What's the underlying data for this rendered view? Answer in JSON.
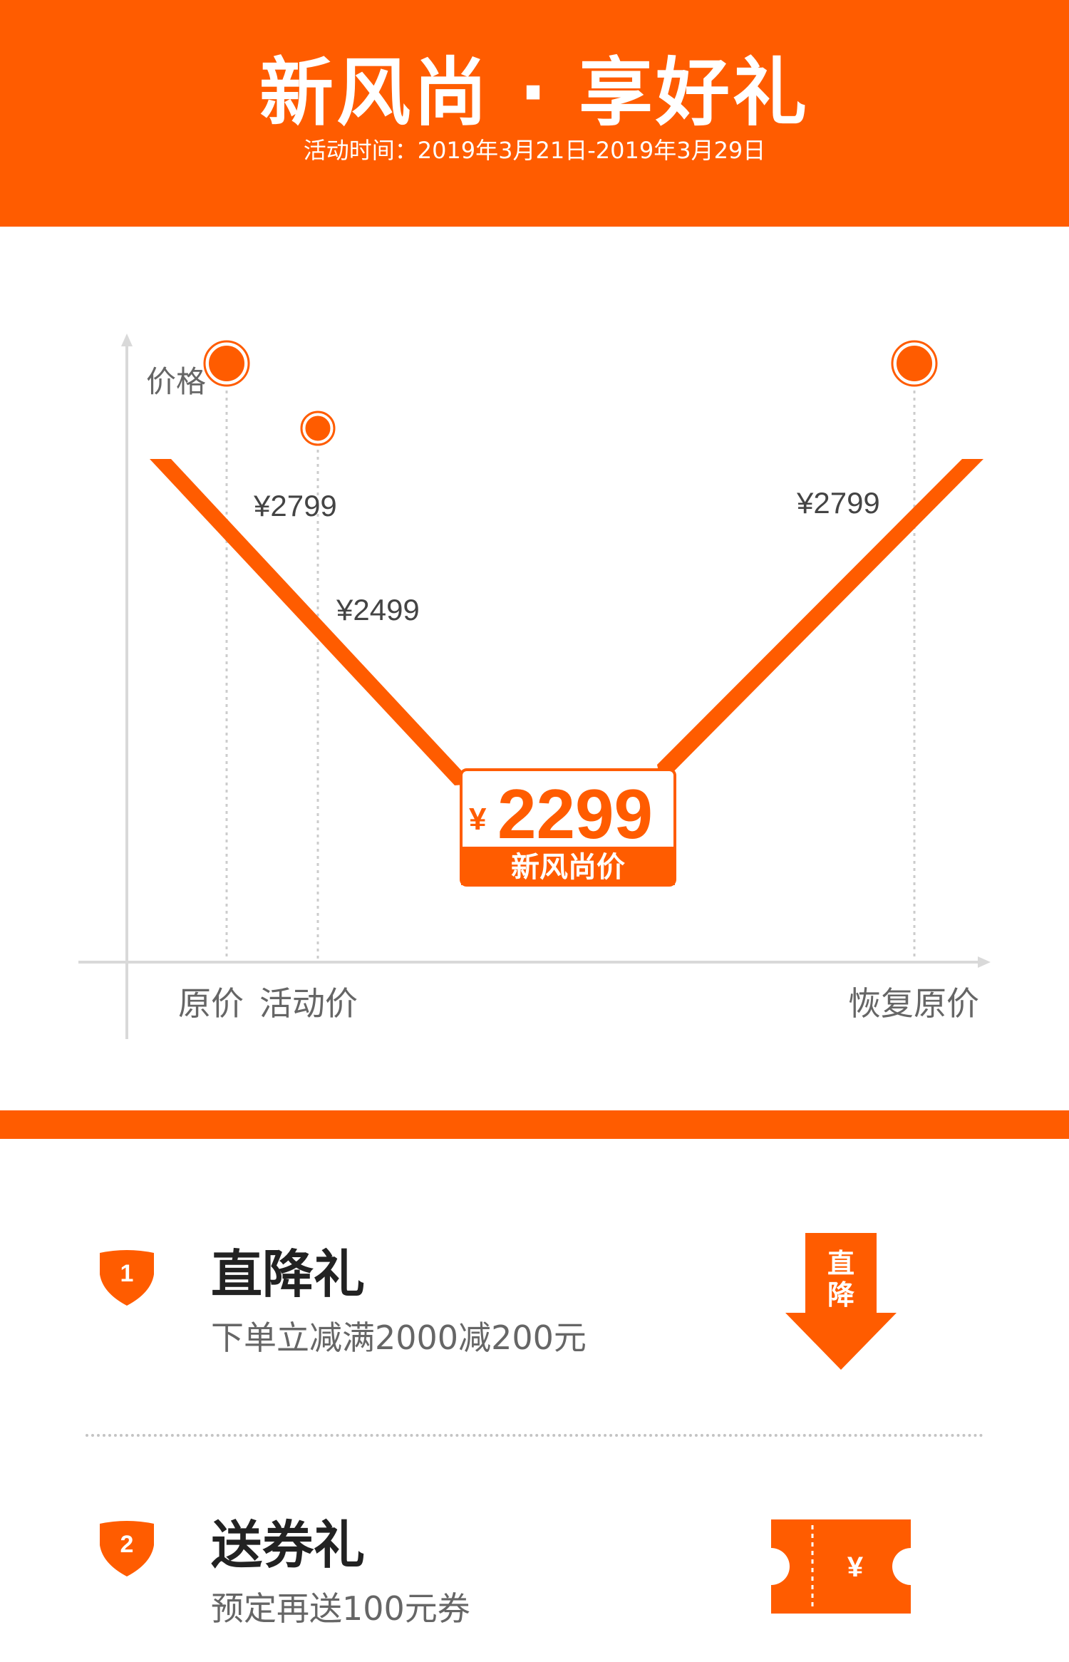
{
  "header": {
    "title": "新风尚 · 享好礼",
    "subtitle": "活动时间：2019年3月21日-2019年3月29日"
  },
  "chart_data": {
    "type": "line",
    "ylabel": "价格",
    "categories": [
      "原价",
      "活动价",
      "新风尚价",
      "恢复原价"
    ],
    "x_labels": [
      "原价",
      "活动价",
      "恢复原价"
    ],
    "values": [
      2799,
      2499,
      2299,
      2799
    ],
    "point_labels": [
      "¥2799",
      "¥2499",
      "¥2799"
    ],
    "highlight": {
      "currency": "¥",
      "value": "2299",
      "label": "新风尚价"
    },
    "grid": false,
    "accent_color": "#FF5C00"
  },
  "gifts": [
    {
      "number": "1",
      "title": "直降礼",
      "description": "下单立减满2000减200元",
      "icon_name": "arrow-down-icon",
      "icon_text": "直降"
    },
    {
      "number": "2",
      "title": "送券礼",
      "description": "预定再送100元券",
      "icon_name": "coupon-ticket-icon",
      "icon_text": "¥"
    }
  ],
  "colors": {
    "brand": "#FF5C00",
    "axis": "#d9d9d9",
    "text_muted": "#666666"
  }
}
